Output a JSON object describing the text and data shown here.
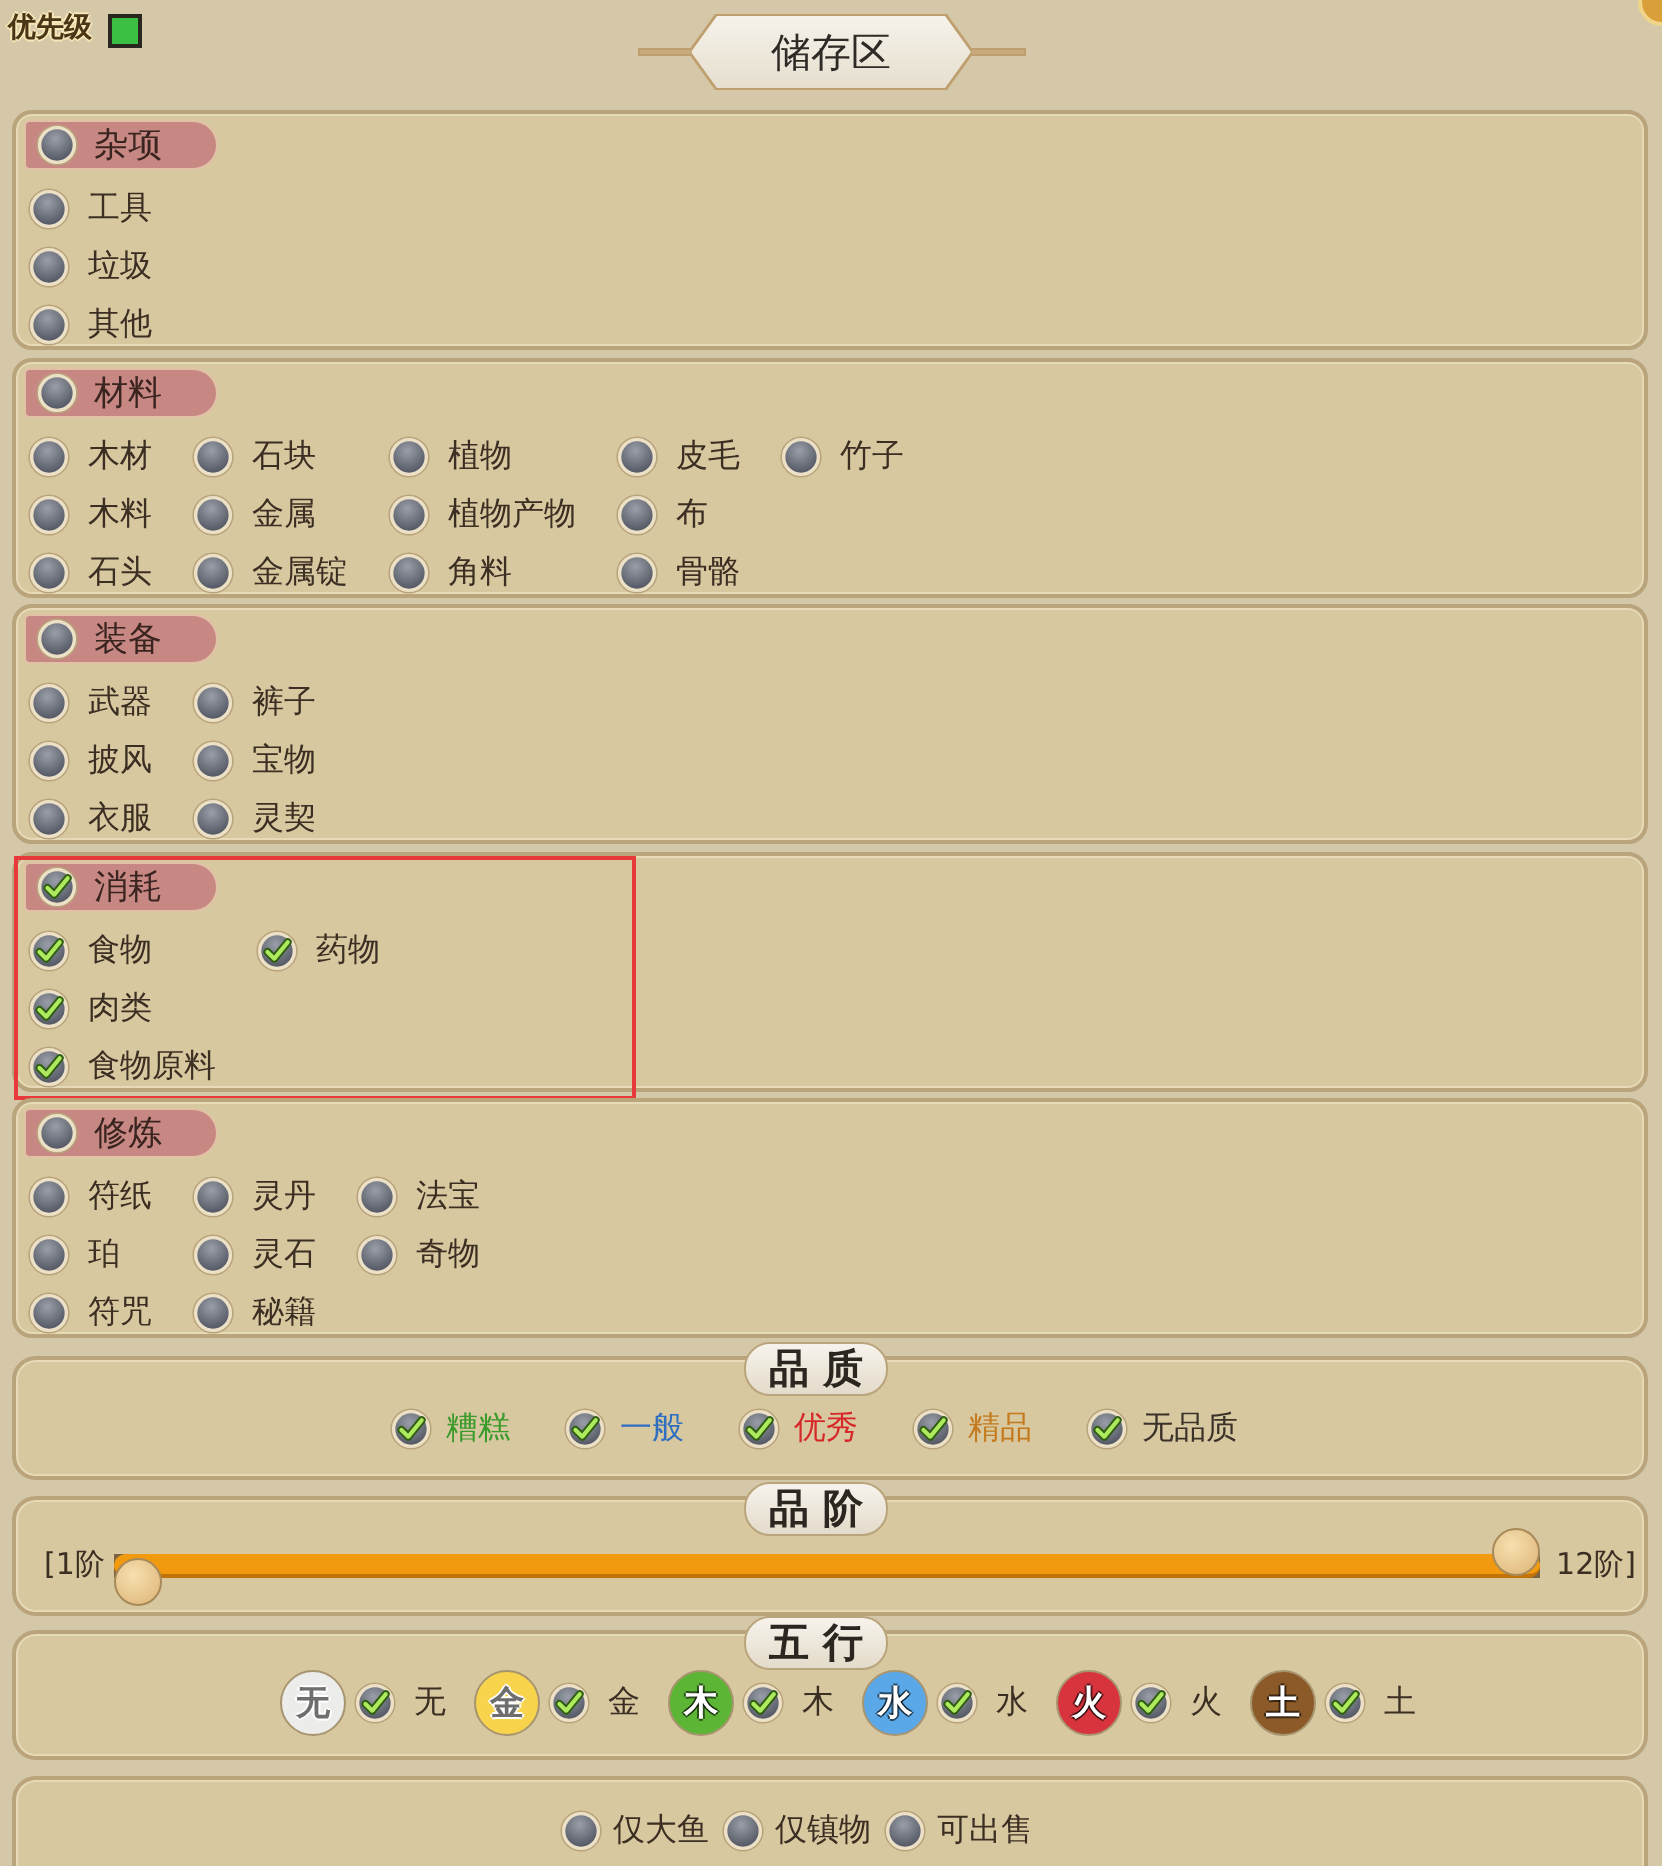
{
  "priority": {
    "label": "优先级"
  },
  "title": "储存区",
  "categories": [
    {
      "name": "杂项",
      "checked": false,
      "highlighted": false,
      "rows": [
        [
          {
            "label": "工具",
            "checked": false
          }
        ],
        [
          {
            "label": "垃圾",
            "checked": false
          }
        ],
        [
          {
            "label": "其他",
            "checked": false
          }
        ]
      ]
    },
    {
      "name": "材料",
      "checked": false,
      "highlighted": false,
      "rows": [
        [
          {
            "label": "木材",
            "checked": false
          },
          {
            "label": "石块",
            "checked": false
          },
          {
            "label": "植物",
            "checked": false
          },
          {
            "label": "皮毛",
            "checked": false
          },
          {
            "label": "竹子",
            "checked": false
          }
        ],
        [
          {
            "label": "木料",
            "checked": false
          },
          {
            "label": "金属",
            "checked": false
          },
          {
            "label": "植物产物",
            "checked": false
          },
          {
            "label": "布",
            "checked": false
          }
        ],
        [
          {
            "label": "石头",
            "checked": false
          },
          {
            "label": "金属锭",
            "checked": false
          },
          {
            "label": "角料",
            "checked": false
          },
          {
            "label": "骨骼",
            "checked": false
          }
        ]
      ]
    },
    {
      "name": "装备",
      "checked": false,
      "highlighted": false,
      "rows": [
        [
          {
            "label": "武器",
            "checked": false
          },
          {
            "label": "裤子",
            "checked": false
          }
        ],
        [
          {
            "label": "披风",
            "checked": false
          },
          {
            "label": "宝物",
            "checked": false
          }
        ],
        [
          {
            "label": "衣服",
            "checked": false
          },
          {
            "label": "灵契",
            "checked": false
          }
        ]
      ]
    },
    {
      "name": "消耗",
      "checked": true,
      "highlighted": true,
      "rows": [
        [
          {
            "label": "食物",
            "checked": true
          },
          {
            "label": "药物",
            "checked": true
          }
        ],
        [
          {
            "label": "肉类",
            "checked": true
          }
        ],
        [
          {
            "label": "食物原料",
            "checked": true
          }
        ]
      ]
    },
    {
      "name": "修炼",
      "checked": false,
      "highlighted": false,
      "rows": [
        [
          {
            "label": "符纸",
            "checked": false
          },
          {
            "label": "灵丹",
            "checked": false
          },
          {
            "label": "法宝",
            "checked": false
          }
        ],
        [
          {
            "label": "珀",
            "checked": false
          },
          {
            "label": "灵石",
            "checked": false
          },
          {
            "label": "奇物",
            "checked": false
          }
        ],
        [
          {
            "label": "符咒",
            "checked": false
          },
          {
            "label": "秘籍",
            "checked": false
          }
        ]
      ]
    }
  ],
  "quality": {
    "title": "品 质",
    "items": [
      {
        "label": "糟糕",
        "checked": true,
        "color": "#3a9a2a"
      },
      {
        "label": "一般",
        "checked": true,
        "color": "#2f6fc0"
      },
      {
        "label": "优秀",
        "checked": true,
        "color": "#d62828"
      },
      {
        "label": "精品",
        "checked": true,
        "color": "#c47a1c"
      },
      {
        "label": "无品质",
        "checked": true,
        "color": "#3a3128"
      }
    ]
  },
  "tier": {
    "title": "品 阶",
    "min_label": "[1阶",
    "max_label": "12阶]",
    "thumbs": [
      {
        "level": 0
      },
      {
        "level": 1
      }
    ]
  },
  "five_elements": {
    "title": "五 行",
    "items": [
      {
        "badge": "无",
        "label": "无",
        "color": "#ececea",
        "checked": true
      },
      {
        "badge": "金",
        "label": "金",
        "color": "#f7d44c",
        "checked": true
      },
      {
        "badge": "木",
        "label": "木",
        "color": "#5db536",
        "checked": true
      },
      {
        "badge": "水",
        "label": "水",
        "color": "#5aa8e8",
        "checked": true
      },
      {
        "badge": "火",
        "label": "火",
        "color": "#d8343e",
        "checked": true
      },
      {
        "badge": "土",
        "label": "土",
        "color": "#8b5a28",
        "checked": true
      }
    ]
  },
  "bottom_filters": [
    {
      "label": "仅大鱼",
      "checked": false
    },
    {
      "label": "仅镇物",
      "checked": false
    },
    {
      "label": "可出售",
      "checked": false
    }
  ]
}
